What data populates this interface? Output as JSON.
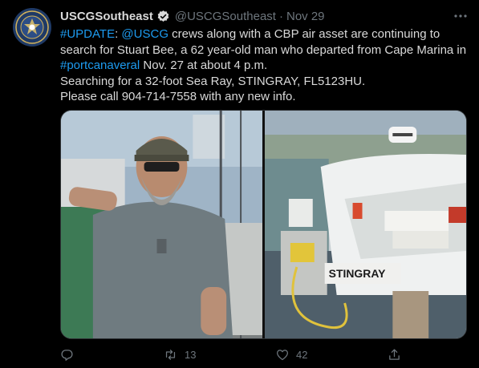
{
  "tweet": {
    "display_name": "USCGSoutheast",
    "handle": "@USCGSoutheast",
    "separator": "·",
    "time": "Nov 29",
    "avatar_icon": "uscg-seal-icon",
    "verified_icon": "verified-badge-icon",
    "body": {
      "line1_hashtag": "#UPDATE",
      "line1_colon": ":",
      "line1_mention": "@USCG",
      "line1_rest": " crews along with a CBP air asset are continuing to search for Stuart Bee, a 62 year-old man who departed from Cape Marina in ",
      "line1_hashtag2": "#portcanaveral",
      "line1_end": " Nov. 27 at about 4 p.m.",
      "line2": "Searching for a 32-foot Sea Ray, STINGRAY, FL5123HU.",
      "line3": "Please call 904-714-7558 with any new info."
    },
    "media": {
      "photo_left": "man-at-marina-photo",
      "photo_right": "sea-ray-boat-photo",
      "boat_name": "STINGRAY"
    },
    "actions": {
      "reply_icon": "reply-icon",
      "reply_count": "",
      "retweet_icon": "retweet-icon",
      "retweet_count": "13",
      "like_icon": "heart-icon",
      "like_count": "42",
      "share_icon": "share-icon"
    },
    "colors": {
      "background": "#000000",
      "text": "#d9d9d9",
      "secondary": "#6e767d",
      "link": "#1d9bf0"
    }
  }
}
